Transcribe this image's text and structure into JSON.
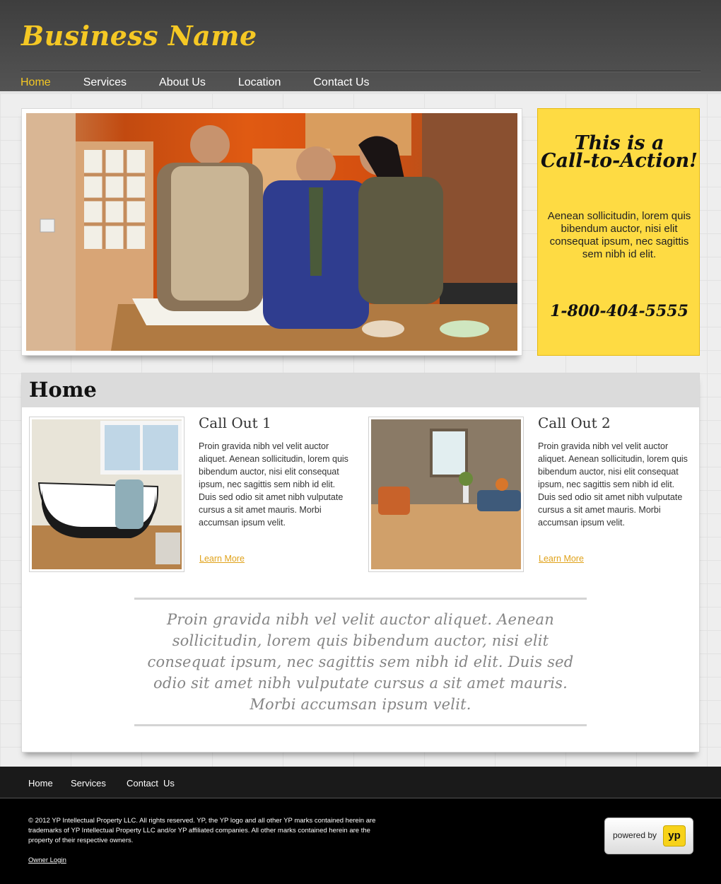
{
  "header": {
    "brand": "Business Name",
    "nav": [
      "Home",
      "Services",
      "About Us",
      "Location",
      "Contact Us"
    ],
    "active_nav": "Home"
  },
  "cta": {
    "title_line1": "This is a",
    "title_line2": "Call-to-Action!",
    "body": "Aenean sollicitudin, lorem quis bibendum auctor, nisi elit consequat ipsum, nec sagittis sem nibh id elit.",
    "phone": "1-800-404-5555"
  },
  "main": {
    "title": "Home",
    "callouts": [
      {
        "title": "Call Out 1",
        "text": "Proin gravida nibh vel velit auctor aliquet. Aenean sollicitudin, lorem quis bibendum auctor, nisi elit consequat ipsum, nec sagittis sem nibh id elit. Duis sed odio sit amet nibh vulputate cursus a sit amet mauris. Morbi accumsan ipsum velit.",
        "link": "Learn More"
      },
      {
        "title": "Call Out 2",
        "text": "Proin gravida nibh vel velit auctor aliquet. Aenean sollicitudin, lorem quis bibendum auctor, nisi elit consequat ipsum, nec sagittis sem nibh id elit. Duis sed odio sit amet nibh vulputate cursus a sit amet mauris. Morbi accumsan ipsum velit.",
        "link": "Learn More"
      }
    ],
    "quote": "Proin gravida nibh vel velit auctor aliquet. Aenean sollicitudin, lorem quis bibendum auctor, nisi elit consequat ipsum, nec sagittis sem nibh id elit. Duis sed odio sit amet nibh vulputate cursus a sit amet mauris. Morbi accumsan ipsum velit."
  },
  "footer": {
    "nav": [
      "Home",
      "Services",
      "Contact  Us"
    ],
    "copyright": "© 2012  YP Intellectual Property LLC. All rights reserved. YP, the YP logo and all other YP marks contained herein are trademarks of YP Intellectual Property LLC and/or YP affiliated companies. All other marks contained herein are the property of their respective owners.",
    "owner_login": "Owner Login",
    "powered_by": "powered by",
    "yp_logo": "yp"
  },
  "colors": {
    "accent": "#f5c824",
    "cta_background": "#fedb43",
    "link": "#e0a21a"
  }
}
